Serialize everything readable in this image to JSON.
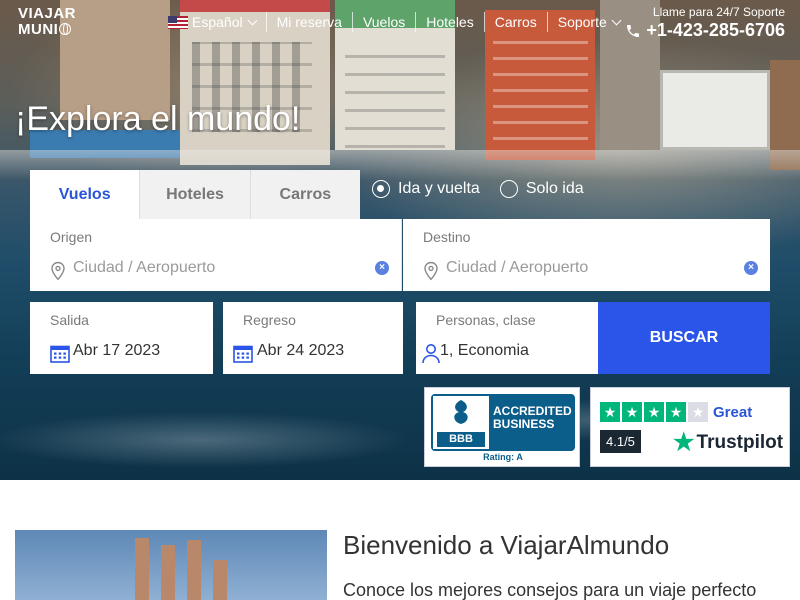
{
  "brand": {
    "logo_line1": "VIAJAR",
    "logo_line2": "MUNI"
  },
  "nav": {
    "language": "Español",
    "items": [
      "Mi reserva",
      "Vuelos",
      "Hoteles",
      "Carros",
      "Soporte"
    ]
  },
  "support": {
    "label": "Llame para 24/7 Soporte",
    "phone": "+1-423-285-6706"
  },
  "hero": {
    "headline": "¡Explora el mundo!"
  },
  "search": {
    "tabs": [
      "Vuelos",
      "Hoteles",
      "Carros"
    ],
    "active_tab": "Vuelos",
    "trip_types": [
      "Ida y vuelta",
      "Solo ida"
    ],
    "selected_trip_type": "Ida y vuelta",
    "origin": {
      "label": "Origen",
      "placeholder": "Ciudad / Aeropuerto"
    },
    "destination": {
      "label": "Destino",
      "placeholder": "Ciudad / Aeropuerto"
    },
    "depart": {
      "label": "Salida",
      "value": "Abr 17 2023"
    },
    "return": {
      "label": "Regreso",
      "value": "Abr 24 2023"
    },
    "passengers": {
      "label": "Personas, clase",
      "value": "1, Economia"
    },
    "submit_label": "BUSCAR"
  },
  "badges": {
    "bbb": {
      "logo_text": "BBB",
      "line1": "ACCREDITED",
      "line2": "BUSINESS",
      "rating": "Rating: A"
    },
    "trustpilot": {
      "verdict": "Great",
      "score": "4.1/5",
      "brand": "Trustpilot",
      "stars_filled": 4,
      "stars_total": 5
    }
  },
  "welcome": {
    "title": "Bienvenido a ViajarAlmundo",
    "subtitle": "Conoce los mejores consejos para un viaje perfecto"
  },
  "colors": {
    "accent": "#2a55e8",
    "tab_active_text": "#2a55d8",
    "trustpilot_green": "#00b67a",
    "bbb_blue": "#0b5d8a"
  },
  "icons": [
    "flag-us-icon",
    "chevron-down-icon",
    "phone-icon",
    "location-pin-icon",
    "clear-icon",
    "calendar-icon",
    "person-icon",
    "star-icon",
    "globe-icon"
  ]
}
